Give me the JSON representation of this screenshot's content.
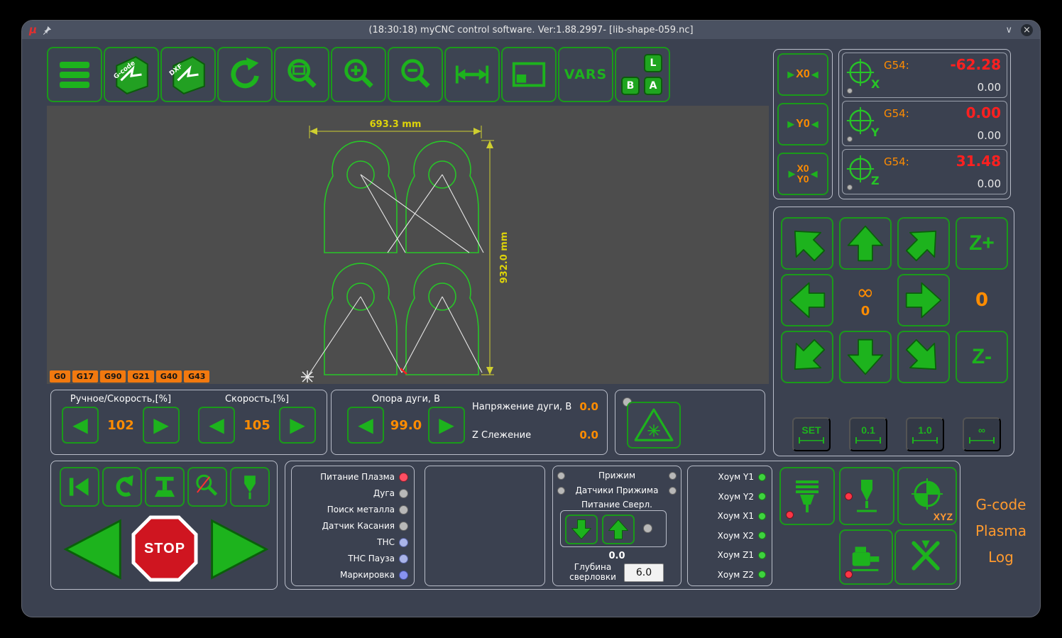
{
  "titlebar": {
    "mu": "μ",
    "title": "(18:30:18) myCNC control software. Ver:1.88.2997- [lib-shape-059.nc]",
    "minimize_glyph": "∨",
    "close_glyph": "×"
  },
  "toolbar": {
    "gcode_label": "G-code",
    "dxf_label": "DXF",
    "vars_label": "VARS",
    "key_l": "L",
    "key_b": "B",
    "key_a": "A"
  },
  "canvas": {
    "width_dim": "693.3 mm",
    "height_dim": "932.0 mm",
    "gcodes": [
      "G0",
      "G17",
      "G90",
      "G21",
      "G40",
      "G43"
    ]
  },
  "zero": {
    "x0": "X0",
    "y0": "Y0",
    "xy_top": "X0",
    "xy_bottom": "Y0"
  },
  "dro": {
    "x": {
      "axis": "X",
      "offset_label": "G54:",
      "value": "-62.28",
      "machine": "0.00"
    },
    "y": {
      "axis": "Y",
      "offset_label": "G54:",
      "value": "0.00",
      "machine": "0.00"
    },
    "z": {
      "axis": "Z",
      "offset_label": "G54:",
      "value": "31.48",
      "machine": "0.00"
    }
  },
  "jog": {
    "z_plus": "Z+",
    "z_minus": "Z-",
    "infinity": "∞",
    "infinity_value": "0",
    "feed_value": "0",
    "steps": [
      "SET",
      "0.1",
      "1.0",
      "∞"
    ]
  },
  "speed_panel": {
    "manual_label": "Ручное/Скорость,[%]",
    "manual_value": "102",
    "program_label": "Скорость,[%]",
    "program_value": "105"
  },
  "arc_panel": {
    "support_label": "Опора дуги, В",
    "support_value": "99.0",
    "voltage_label": "Напряжение дуги, В",
    "voltage_value": "0.0",
    "tracking_label": "Z Слежение",
    "tracking_value": "0.0"
  },
  "run_panel": {
    "stop_label": "STOP"
  },
  "status_panel": {
    "items": [
      {
        "label": "Питание Плазма",
        "led": "#ff4f63"
      },
      {
        "label": "Дуга",
        "led": "#b8b8b8"
      },
      {
        "label": "Поиск металла",
        "led": "#b8b8b8"
      },
      {
        "label": "Датчик Касания",
        "led": "#b8b8b8"
      },
      {
        "label": "ТНС",
        "led": "#aab4e8"
      },
      {
        "label": "ТНС Пауза",
        "led": "#aab4e8"
      },
      {
        "label": "Маркировка",
        "led": "#8892f0"
      }
    ]
  },
  "clamp_panel": {
    "clamp_label": "Прижим",
    "sensors_label": "Датчики Прижима",
    "drill_power_label": "Питание Сверл.",
    "position_value": "0.0",
    "depth_line1": "Глубина",
    "depth_line2": "сверловки",
    "depth_value": "6.0"
  },
  "home_panel": {
    "items": [
      "Хоум Y1",
      "Хоум Y2",
      "Хоум X1",
      "Хоум X2",
      "Хоум Z1",
      "Хоум Z2"
    ]
  },
  "tool_panel": {
    "xyz_label": "XYZ"
  },
  "tabs": {
    "gcode": "G-code",
    "plasma": "Plasma",
    "log": "Log"
  },
  "colors": {
    "accent_green": "#1db31d",
    "accent_orange": "#ff8c00",
    "value_red": "#ff2020",
    "dimension_yellow": "#d6d606",
    "led_green": "#3ed43e",
    "led_red": "#ff4f63",
    "canvas_gray": "#4d4d4d",
    "window_bg": "#3b4150"
  }
}
